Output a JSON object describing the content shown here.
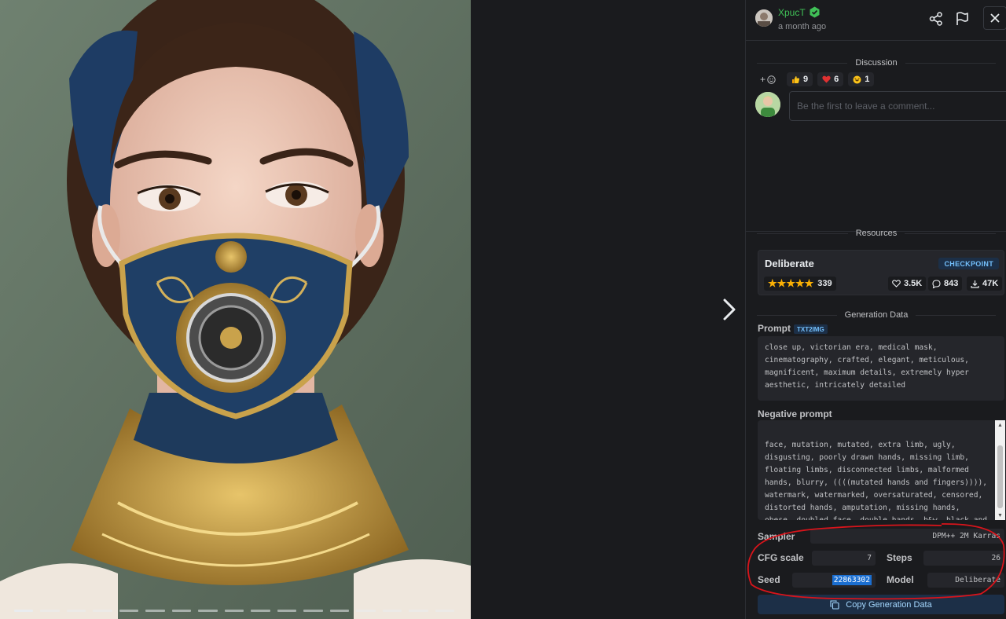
{
  "viewer": {
    "image_alt": "Portrait of a woman wearing an ornate Victorian-style blue and gold mask with a circular valve and a matching gold embroidered collar",
    "slide_count": 17,
    "active_slide": 1
  },
  "header": {
    "username": "XpucT",
    "time": "a month ago",
    "verified_color": "#40c057"
  },
  "discussion": {
    "label": "Discussion",
    "add_reaction": "+",
    "reactions": [
      {
        "icon": "thumbs-up",
        "count": "9"
      },
      {
        "icon": "heart",
        "count": "6"
      },
      {
        "icon": "laughing",
        "count": "1"
      }
    ],
    "comment_placeholder": "Be the first to leave a comment..."
  },
  "resources": {
    "label": "Resources",
    "name": "Deliberate",
    "type": "CHECKPOINT",
    "rating": 5,
    "rating_count": "339",
    "likes": "3.5K",
    "comments": "843",
    "downloads": "47K"
  },
  "generation": {
    "label": "Generation Data",
    "prompt_label": "Prompt",
    "prompt_badge": "TXT2IMG",
    "prompt": "close up, victorian era, medical mask, cinematography, crafted, elegant, meticulous, magnificent, maximum details, extremely hyper aesthetic, intricately detailed",
    "negative_label": "Negative prompt",
    "negative_prompt": "face, mutation, mutated, extra limb, ugly, disgusting, poorly drawn hands, missing limb, floating limbs, disconnected limbs, malformed hands, blurry, ((((mutated hands and fingers)))), watermark, watermarked, oversaturated, censored, distorted hands, amputation, missing hands, obese, doubled face, double hands, b&w, black and white, sepia, flowers, roses",
    "sampler_label": "Sampler",
    "sampler": "DPM++ 2M Karras",
    "cfg_label": "CFG scale",
    "cfg": "7",
    "steps_label": "Steps",
    "steps": "26",
    "seed_label": "Seed",
    "seed": "22863302",
    "model_label": "Model",
    "model": "Deliberate",
    "copy_label": "Copy Generation Data"
  },
  "colors": {
    "accent": "#74c0fc",
    "annotation": "#d9141b",
    "star": "#fab005"
  }
}
